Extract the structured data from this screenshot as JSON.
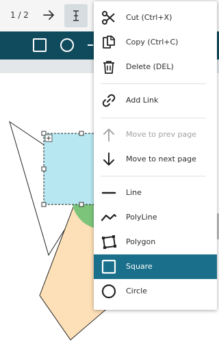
{
  "toolbar": {
    "page_indicator": "1 / 2",
    "icons": [
      "arrow-right-icon",
      "text-cursor-icon"
    ]
  },
  "shape_toolbar": {
    "icons": [
      "square-icon",
      "circle-icon"
    ]
  },
  "context_menu": {
    "items": [
      {
        "label": "Cut (Ctrl+X)",
        "icon": "scissors-icon",
        "enabled": true
      },
      {
        "label": "Copy (Ctrl+C)",
        "icon": "copy-icon",
        "enabled": true
      },
      {
        "label": "Delete (DEL)",
        "icon": "trash-icon",
        "enabled": true
      },
      {
        "label": "Add Link",
        "icon": "link-icon",
        "enabled": true
      },
      {
        "label": "Move to prev page",
        "icon": "arrow-up-icon",
        "enabled": false
      },
      {
        "label": "Move to next page",
        "icon": "arrow-down-icon",
        "enabled": true
      },
      {
        "label": "Line",
        "icon": "line-icon",
        "enabled": true
      },
      {
        "label": "PolyLine",
        "icon": "polyline-icon",
        "enabled": true
      },
      {
        "label": "Polygon",
        "icon": "polygon-icon",
        "enabled": true
      },
      {
        "label": "Square",
        "icon": "square-icon",
        "enabled": true,
        "selected": true
      },
      {
        "label": "Circle",
        "icon": "circle-icon",
        "enabled": true
      }
    ]
  },
  "colors": {
    "toolbar_dark": "#104b5d",
    "selected_item": "#1a6f8a",
    "square_fill": "#b7e7f0",
    "polygon_fill": "#fde0b8",
    "circle_fill": "#7cc47a"
  }
}
